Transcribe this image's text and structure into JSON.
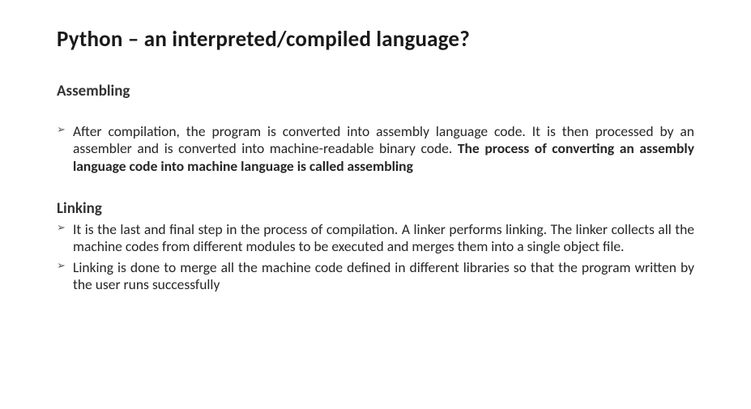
{
  "title": "Python – an interpreted/compiled language?",
  "sections": {
    "assembling": {
      "heading": "Assembling",
      "bullet1_part1": "After compilation, the program is converted into assembly language code. It is then processed by an assembler and is converted into machine-readable binary code. ",
      "bullet1_bold": "The process of converting an assembly language code into machine language is called assembling"
    },
    "linking": {
      "heading": "Linking",
      "bullet1": "It is the last and final step in the process of compilation. A linker performs linking. The linker collects all the machine codes from different modules to be executed and merges them into a single object file.",
      "bullet2": "Linking is done to merge all the machine code defined in different libraries so that the program written by the user runs successfully"
    }
  },
  "bullet_glyph": "➢"
}
